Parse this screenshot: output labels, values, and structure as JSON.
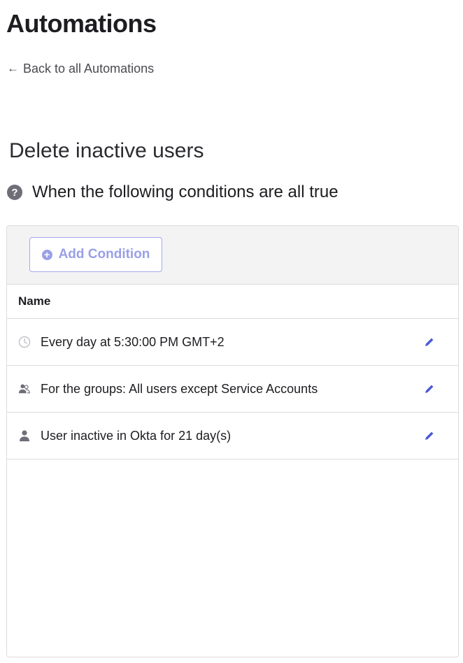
{
  "page": {
    "title": "Automations",
    "back_link": "Back to all Automations"
  },
  "automation": {
    "name": "Delete inactive users",
    "conditions_heading": "When the following conditions are all true"
  },
  "toolbar": {
    "add_condition_label": "Add Condition"
  },
  "table": {
    "column_header": "Name",
    "rows": [
      {
        "icon": "clock-icon",
        "label": "Every day at 5:30:00 PM GMT+2"
      },
      {
        "icon": "group-icon",
        "label": "For the groups: All users except Service Accounts"
      },
      {
        "icon": "user-icon",
        "label": "User inactive in Okta for 21 day(s)"
      }
    ]
  },
  "colors": {
    "accent": "#4c5bd4",
    "accent_light": "#9aa0e6",
    "panel_bg": "#f3f3f4",
    "border": "#dcdce0"
  }
}
